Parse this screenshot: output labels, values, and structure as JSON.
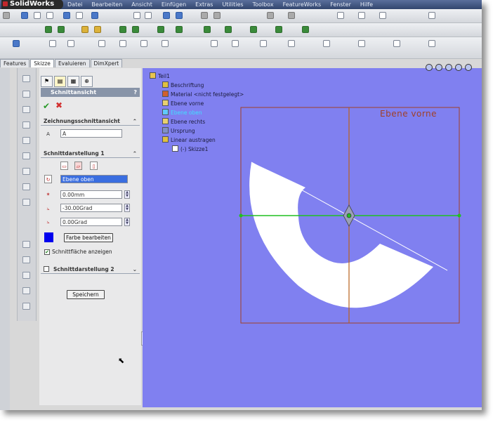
{
  "app": {
    "logo": "SolidWorks"
  },
  "menu": [
    "Datei",
    "Bearbeiten",
    "Ansicht",
    "Einfügen",
    "Extras",
    "Utilities",
    "Toolbox",
    "FeatureWorks",
    "Fenster",
    "Hilfe"
  ],
  "left_tabs": [
    "Features",
    "Skizze",
    "Evaluieren",
    "DimXpert"
  ],
  "property_manager": {
    "title": "Schnittansicht",
    "help": "?",
    "group1": {
      "title": "Zeichnungsschnittansicht",
      "chevron": "⌃",
      "label_value": "A"
    },
    "group2": {
      "title": "Schnittdarstellung 1",
      "chevron": "⌃"
    },
    "plane_value": "Ebene oben",
    "offset_value": "0.00mm",
    "angle1_value": "-30.00Grad",
    "angle2_value": "0.00Grad",
    "color_button": "Farbe bearbeiten",
    "show_surface_checkbox": "Schnittfläche anzeigen",
    "group3": {
      "title": "Schnittdarstellung 2",
      "chevron": "⌄"
    },
    "save_button": "Speichern"
  },
  "feature_tree": {
    "root": "Teil1",
    "items": [
      "Beschriftung",
      "Material <nicht festgelegt>",
      "Ebene vorne",
      "Ebene oben",
      "Ebene rechts",
      "Ursprung",
      "Linear austragen",
      "(-) Skizze1"
    ]
  },
  "viewport": {
    "plane_label": "Ebene vorne"
  },
  "colors": {
    "viewport_bg": "#8080f0",
    "selected_plane_text": "#40e0ff",
    "section_color": "#0000ee",
    "sketch_line": "#20c020",
    "plane_frame": "#a04028"
  }
}
